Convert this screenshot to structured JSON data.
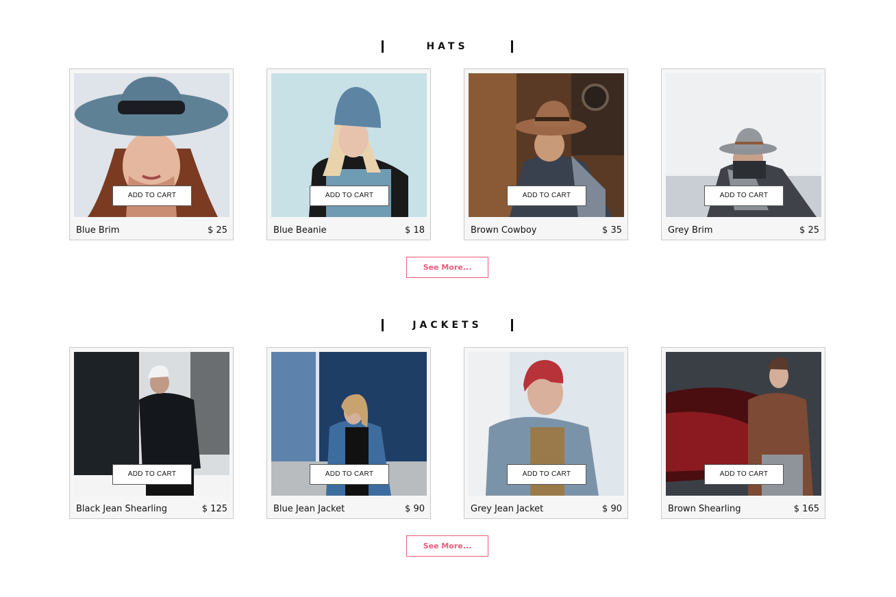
{
  "sections": [
    {
      "title": "HATS",
      "see_more": "See More...",
      "products": [
        {
          "name": "Blue Brim",
          "price": "$ 25",
          "add_label": "ADD TO CART",
          "icon": "woman-blue-brim-hat-photo"
        },
        {
          "name": "Blue Beanie",
          "price": "$ 18",
          "add_label": "ADD TO CART",
          "icon": "woman-blue-beanie-photo"
        },
        {
          "name": "Brown Cowboy",
          "price": "$ 35",
          "add_label": "ADD TO CART",
          "icon": "man-brown-cowboy-hat-photo"
        },
        {
          "name": "Grey Brim",
          "price": "$ 25",
          "add_label": "ADD TO CART",
          "icon": "man-grey-brim-hat-photo"
        }
      ]
    },
    {
      "title": "JACKETS",
      "see_more": "See More...",
      "products": [
        {
          "name": "Black Jean Shearling",
          "price": "$ 125",
          "add_label": "ADD TO CART",
          "icon": "man-black-jean-shearling-photo"
        },
        {
          "name": "Blue Jean Jacket",
          "price": "$ 90",
          "add_label": "ADD TO CART",
          "icon": "woman-blue-jean-jacket-photo"
        },
        {
          "name": "Grey Jean Jacket",
          "price": "$ 90",
          "add_label": "ADD TO CART",
          "icon": "man-grey-jean-jacket-photo"
        },
        {
          "name": "Brown Shearling",
          "price": "$ 165",
          "add_label": "ADD TO CART",
          "icon": "man-brown-shearling-photo"
        }
      ]
    }
  ],
  "colors": {
    "accent": "#ec5b7b",
    "card_bg": "#f6f6f6",
    "card_border": "#c9c9c9",
    "text": "#111111"
  }
}
